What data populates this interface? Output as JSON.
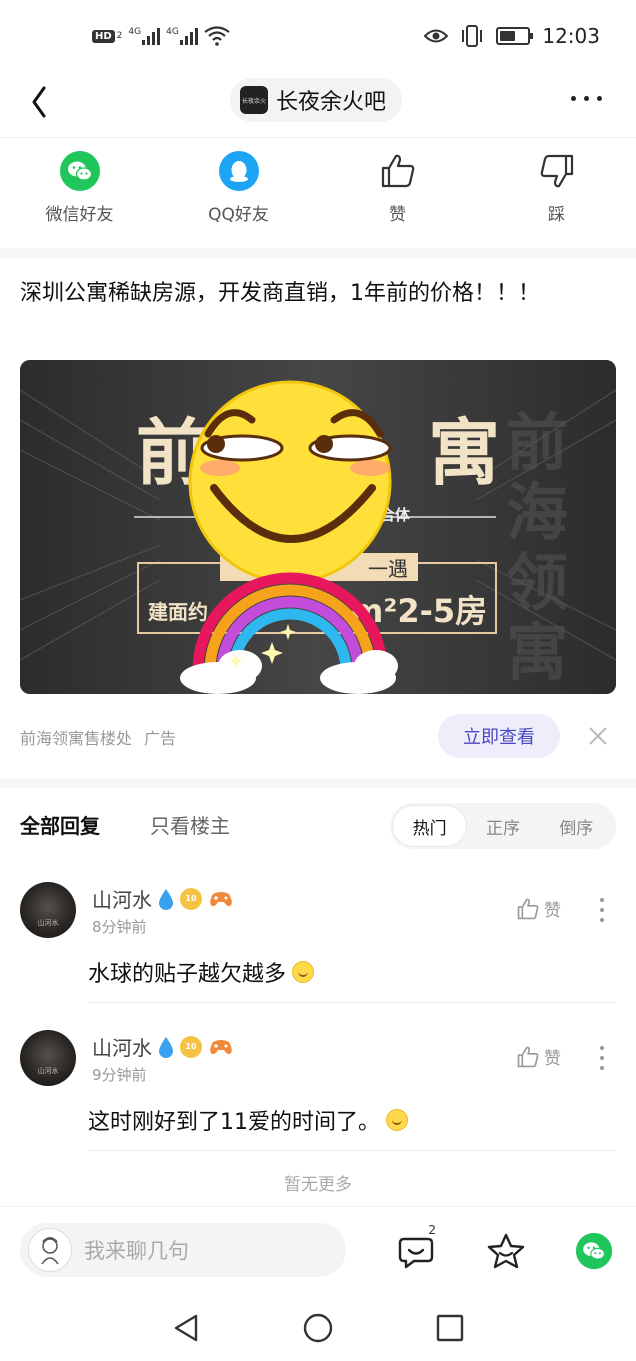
{
  "status_bar": {
    "hd_label": "HD",
    "hd_sub": "2",
    "signal1_label": "4G",
    "signal2_label": "4G",
    "time": "12:03",
    "battery_level": 0.55
  },
  "header": {
    "forum_name": "长夜余火吧",
    "forum_avatar_text": "长夜余火"
  },
  "share": {
    "items": [
      {
        "label": "微信好友",
        "icon": "wechat-icon"
      },
      {
        "label": "QQ好友",
        "icon": "qq-icon"
      },
      {
        "label": "赞",
        "icon": "thumbs-up-icon"
      },
      {
        "label": "踩",
        "icon": "thumbs-down-icon"
      }
    ]
  },
  "ad": {
    "title": "深圳公寓稀缺房源，开发商直销，1年前的价格！！！",
    "banner_big_left": "前",
    "banner_big_right": "寓",
    "banner_sub": "合体",
    "banner_tag": "一遇",
    "banner_info_left": "建面约",
    "banner_info_right": "m²2-5房",
    "banner_side_text": "前海领寓",
    "advertiser": "前海领寓售楼处",
    "ad_label": "广告",
    "cta_label": "立即查看"
  },
  "replies": {
    "tab_all": "全部回复",
    "tab_owner": "只看楼主",
    "sort_options": [
      "热门",
      "正序",
      "倒序"
    ],
    "sort_active": "热门",
    "like_label": "赞",
    "comments": [
      {
        "user": "山河水",
        "time": "8分钟前",
        "text": "水球的贴子越欠越多",
        "level": "10",
        "avatar_text": "山河水"
      },
      {
        "user": "山河水",
        "time": "9分钟前",
        "text": "这时刚好到了11爱的时间了。",
        "level": "10",
        "avatar_text": "山河水"
      }
    ],
    "no_more": "暂无更多"
  },
  "bottom_bar": {
    "input_placeholder": "我来聊几句",
    "comment_count": "2"
  },
  "colors": {
    "accent": "#4b48c6",
    "wechat_green": "#1fc65c",
    "qq_blue": "#1ea4f5"
  }
}
